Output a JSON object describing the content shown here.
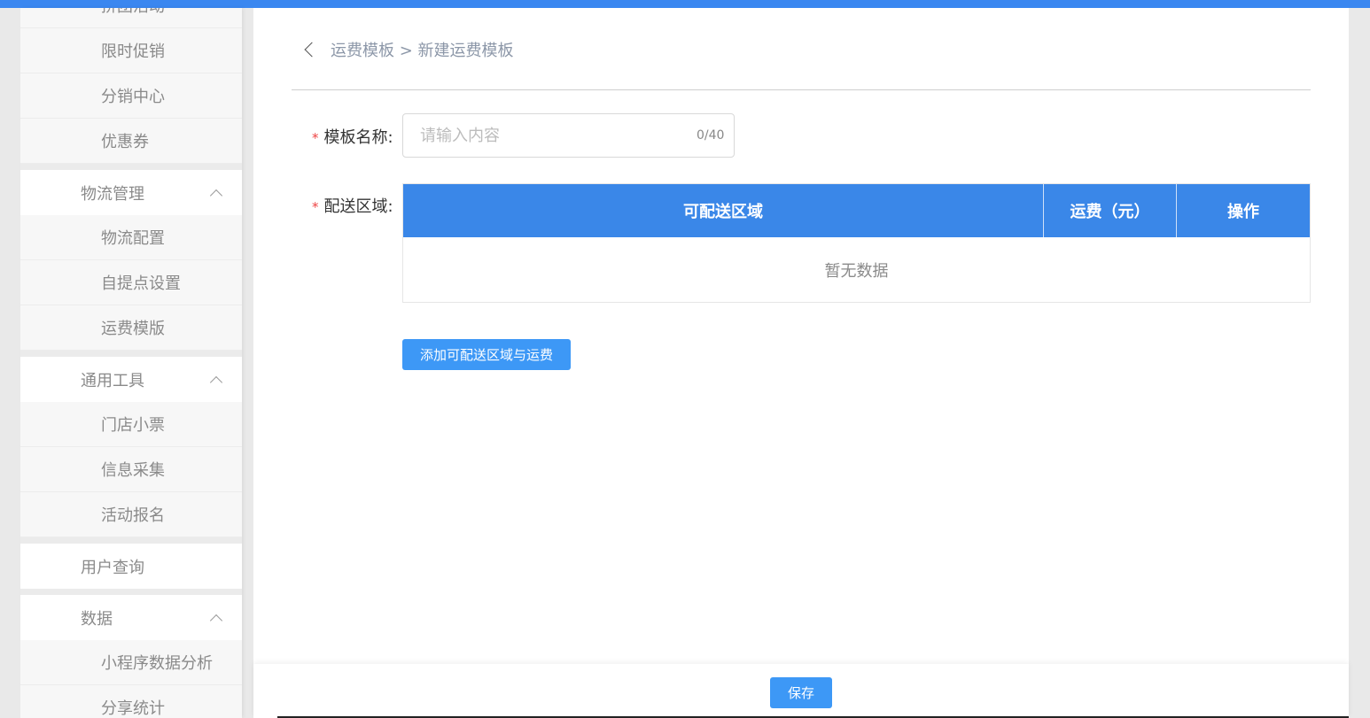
{
  "sidebar": {
    "partial_top": "拼团活动",
    "groups": [
      {
        "sub": [
          "限时促销",
          "分销中心",
          "优惠券"
        ]
      },
      {
        "label": "物流管理",
        "sub": [
          "物流配置",
          "自提点设置",
          "运费模版"
        ]
      },
      {
        "label": "通用工具",
        "sub": [
          "门店小票",
          "信息采集",
          "活动报名"
        ]
      },
      {
        "label": "用户查询"
      },
      {
        "label": "数据",
        "sub": [
          "小程序数据分析",
          "分享统计"
        ]
      }
    ]
  },
  "breadcrumb": {
    "parent": "运费模板",
    "separator": " > ",
    "current": "新建运费模板"
  },
  "form": {
    "name_label": "模板名称:",
    "name_placeholder": "请输入内容",
    "name_value": "",
    "name_counter": "0/40",
    "area_label": "配送区域:",
    "required_mark": "*"
  },
  "table": {
    "columns": [
      "可配送区域",
      "运费（元）",
      "操作"
    ],
    "empty_text": "暂无数据"
  },
  "buttons": {
    "add_area": "添加可配送区域与运费",
    "save": "保存"
  },
  "colors": {
    "accent": "#3a87e8",
    "button": "#3d98f6",
    "required": "#e44444"
  }
}
